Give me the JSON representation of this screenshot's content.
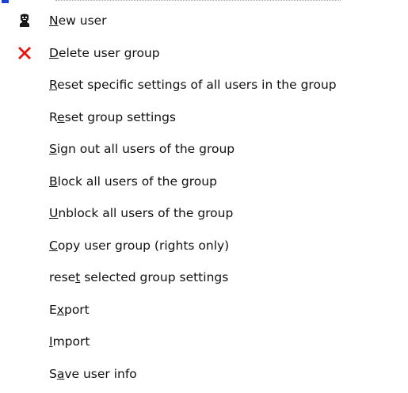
{
  "menu": {
    "items": [
      {
        "label": "New user",
        "mnemonic_index": 0,
        "icon": "user-icon"
      },
      {
        "label": "Delete user group",
        "mnemonic_index": 0,
        "icon": "close-icon"
      },
      {
        "label": "Reset specific settings of all users in the group",
        "mnemonic_index": 0,
        "icon": ""
      },
      {
        "label": "Reset group settings",
        "mnemonic_index": 1,
        "icon": ""
      },
      {
        "label": "Sign out all users of the group",
        "mnemonic_index": 0,
        "icon": ""
      },
      {
        "label": "Block all users of the group",
        "mnemonic_index": 0,
        "icon": ""
      },
      {
        "label": "Unblock all users of the group",
        "mnemonic_index": 0,
        "icon": ""
      },
      {
        "label": "Copy user group (rights only)",
        "mnemonic_index": 0,
        "icon": ""
      },
      {
        "label": "reset selected group settings",
        "mnemonic_index": 4,
        "icon": ""
      },
      {
        "label": "Export",
        "mnemonic_index": 1,
        "icon": ""
      },
      {
        "label": "Import",
        "mnemonic_index": 0,
        "icon": ""
      },
      {
        "label": "Save user info",
        "mnemonic_index": 1,
        "icon": ""
      }
    ]
  },
  "colors": {
    "delete_icon": "#e8150f",
    "user_icon": "#1a1a1a",
    "text": "#111111"
  }
}
